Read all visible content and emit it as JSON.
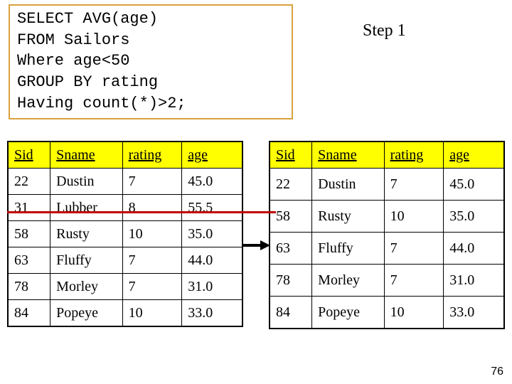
{
  "sql": {
    "line1": "SELECT AVG(age)",
    "line2": "FROM Sailors",
    "line3": "Where age<50",
    "line4": "GROUP BY rating",
    "line5": "Having count(*)>2;"
  },
  "step_label": "Step 1",
  "headers": {
    "c1": "Sid",
    "c2": "Sname",
    "c3": "rating",
    "c4": "age"
  },
  "left_table": {
    "rows": [
      {
        "sid": "22",
        "sname": "Dustin",
        "rating": "7",
        "age": "45.0"
      },
      {
        "sid": "31",
        "sname": "Lubber",
        "rating": "8",
        "age": "55.5"
      },
      {
        "sid": "58",
        "sname": "Rusty",
        "rating": "10",
        "age": "35.0"
      },
      {
        "sid": "63",
        "sname": "Fluffy",
        "rating": "7",
        "age": "44.0"
      },
      {
        "sid": "78",
        "sname": "Morley",
        "rating": "7",
        "age": "31.0"
      },
      {
        "sid": "84",
        "sname": "Popeye",
        "rating": "10",
        "age": "33.0"
      }
    ]
  },
  "right_table": {
    "rows": [
      {
        "sid": "22",
        "sname": "Dustin",
        "rating": "7",
        "age": "45.0"
      },
      {
        "sid": "58",
        "sname": "Rusty",
        "rating": "10",
        "age": "35.0"
      },
      {
        "sid": "63",
        "sname": "Fluffy",
        "rating": "7",
        "age": "44.0"
      },
      {
        "sid": "78",
        "sname": "Morley",
        "rating": "7",
        "age": "31.0"
      },
      {
        "sid": "84",
        "sname": "Popeye",
        "rating": "10",
        "age": "33.0"
      }
    ]
  },
  "page_number": "76"
}
